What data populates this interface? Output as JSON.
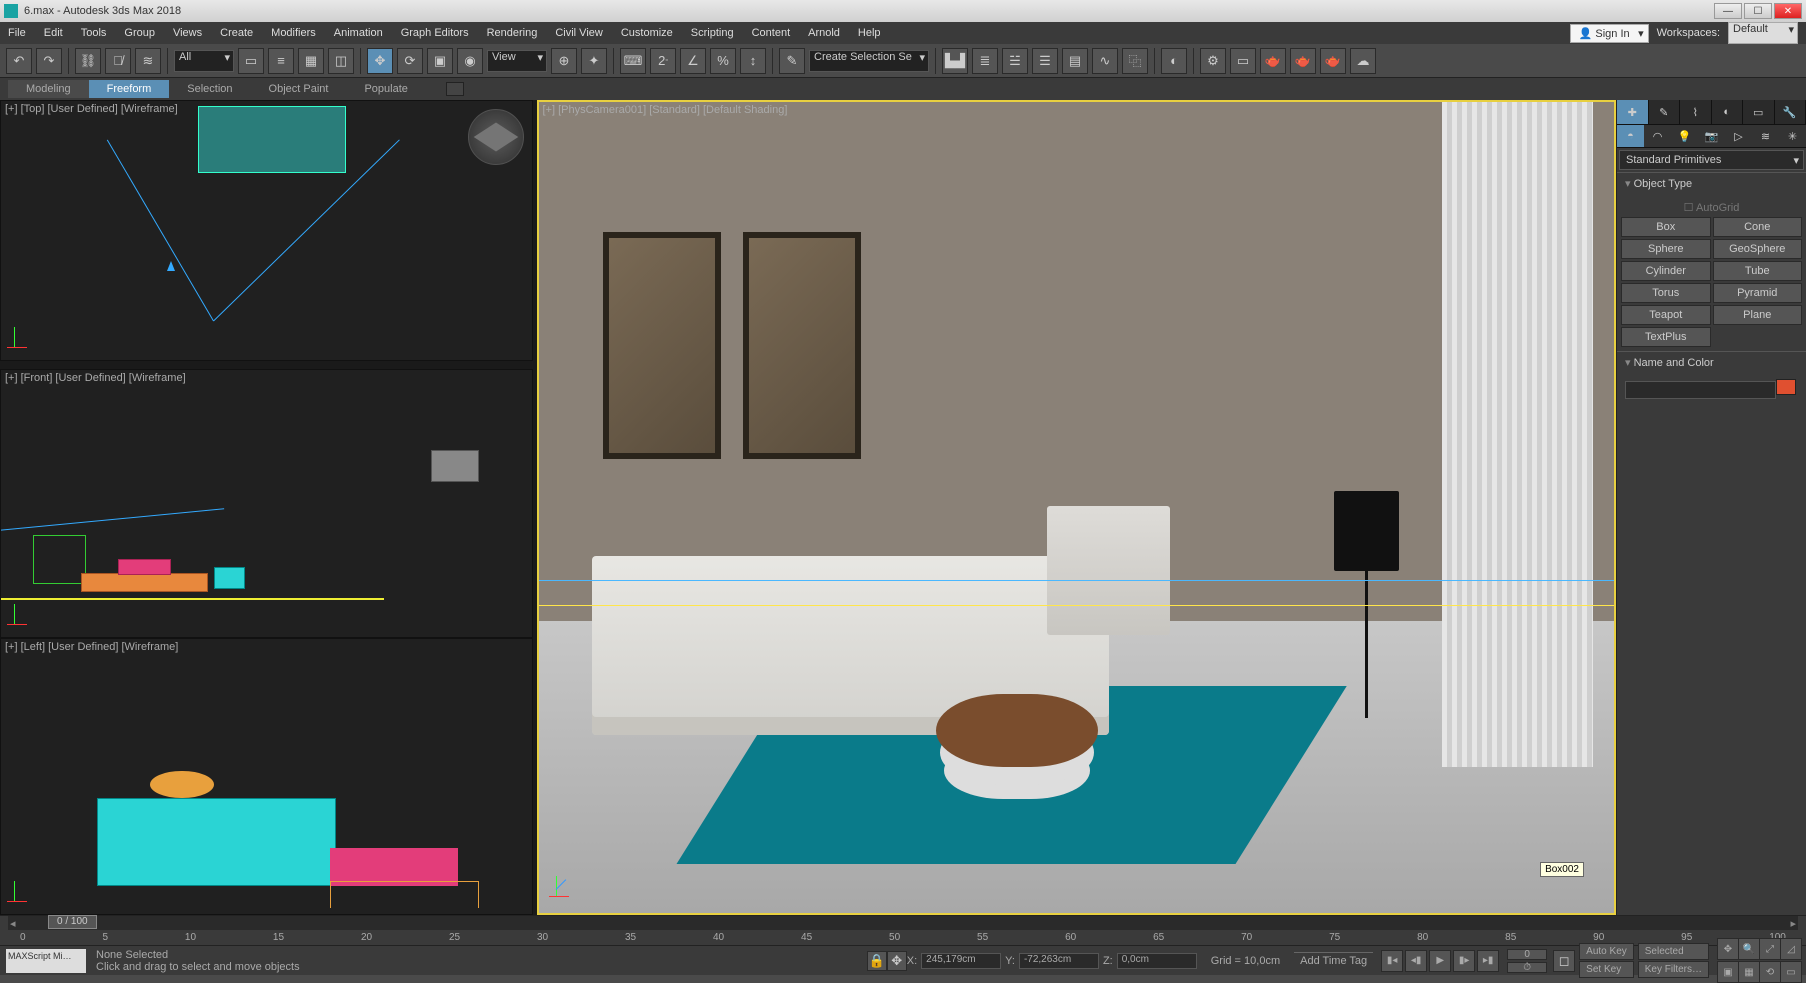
{
  "title": "6.max - Autodesk 3ds Max 2018",
  "menu": [
    "File",
    "Edit",
    "Tools",
    "Group",
    "Views",
    "Create",
    "Modifiers",
    "Animation",
    "Graph Editors",
    "Rendering",
    "Civil View",
    "Customize",
    "Scripting",
    "Content",
    "Arnold",
    "Help"
  ],
  "signin": "Sign In",
  "workspaces_label": "Workspaces:",
  "workspaces_value": "Default",
  "toolbar": {
    "all": "All",
    "view": "View",
    "create_set": "Create Selection Se"
  },
  "ribbon": [
    "Modeling",
    "Freeform",
    "Selection",
    "Object Paint",
    "Populate"
  ],
  "ribbon_active": 1,
  "viewports": {
    "top": "[+] [Top] [User Defined] [Wireframe]",
    "front": "[+] [Front] [User Defined] [Wireframe]",
    "left": "[+] [Left] [User Defined] [Wireframe]",
    "persp": "[+] [PhysCamera001] [Standard] [Default Shading]"
  },
  "tooltip": "Box002",
  "cp": {
    "dropdown": "Standard Primitives",
    "rollout_objtype": "Object Type",
    "autogrid": "AutoGrid",
    "primitives": [
      [
        "Box",
        "Cone"
      ],
      [
        "Sphere",
        "GeoSphere"
      ],
      [
        "Cylinder",
        "Tube"
      ],
      [
        "Torus",
        "Pyramid"
      ],
      [
        "Teapot",
        "Plane"
      ],
      [
        "TextPlus",
        ""
      ]
    ],
    "rollout_namecol": "Name and Color"
  },
  "timeline": {
    "thumb": "0 / 100",
    "ticks": [
      "0",
      "5",
      "10",
      "15",
      "20",
      "25",
      "30",
      "35",
      "40",
      "45",
      "50",
      "55",
      "60",
      "65",
      "70",
      "75",
      "80",
      "85",
      "90",
      "95",
      "100"
    ]
  },
  "status": {
    "script": "MAXScript Mi…",
    "sel": "None Selected",
    "hint": "Click and drag to select and move objects",
    "x_label": "X:",
    "x": "245,179cm",
    "y_label": "Y:",
    "y": "-72,263cm",
    "z_label": "Z:",
    "z": "0,0cm",
    "grid": "Grid = 10,0cm",
    "timetag": "Add Time Tag",
    "autokey": "Auto Key",
    "setkey": "Set Key",
    "selected": "Selected",
    "keyfilters": "Key Filters…"
  }
}
